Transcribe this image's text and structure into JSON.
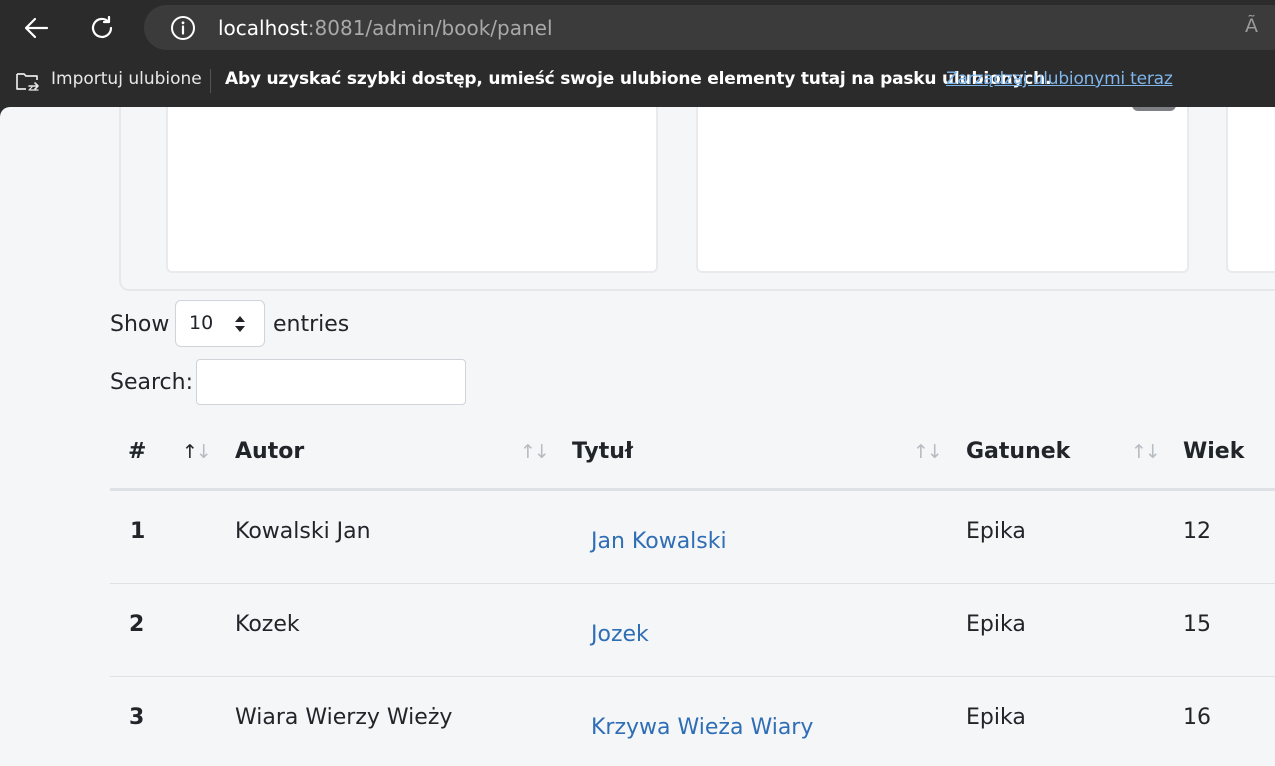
{
  "browser": {
    "url_host": "localhost",
    "url_rest": ":8081/admin/book/panel",
    "read_aloud": "Ã"
  },
  "favorites_bar": {
    "import_label": "Importuj ulubione",
    "message": "Aby uzyskać szybki dostęp, umieść swoje ulubione elementy tutaj na pasku ulubionych.",
    "manage_link": "Zarządzaj ulubionymi teraz"
  },
  "datatable": {
    "show_label": "Show",
    "length_value": "10",
    "entries_label": "entries",
    "search_label": "Search:",
    "search_value": ""
  },
  "table": {
    "columns": [
      "#",
      "Autor",
      "Tytuł",
      "Gatunek",
      "Wiek"
    ],
    "sort_glyph": "↑↓",
    "rows": [
      {
        "num": "1",
        "autor": "Kowalski Jan",
        "tytul": "Jan Kowalski",
        "gatunek": "Epika",
        "wiek": "12"
      },
      {
        "num": "2",
        "autor": "Kozek",
        "tytul": "Jozek",
        "gatunek": "Epika",
        "wiek": "15"
      },
      {
        "num": "3",
        "autor": "Wiara Wierzy Wieży",
        "tytul": "Krzywa Wieża Wiary",
        "gatunek": "Epika",
        "wiek": "16"
      }
    ]
  },
  "colors": {
    "link": "#2f6eb5",
    "favorites_link": "#7fb6ec",
    "browser_chrome": "#2b2b2b",
    "page_background": "#f5f6f8"
  }
}
